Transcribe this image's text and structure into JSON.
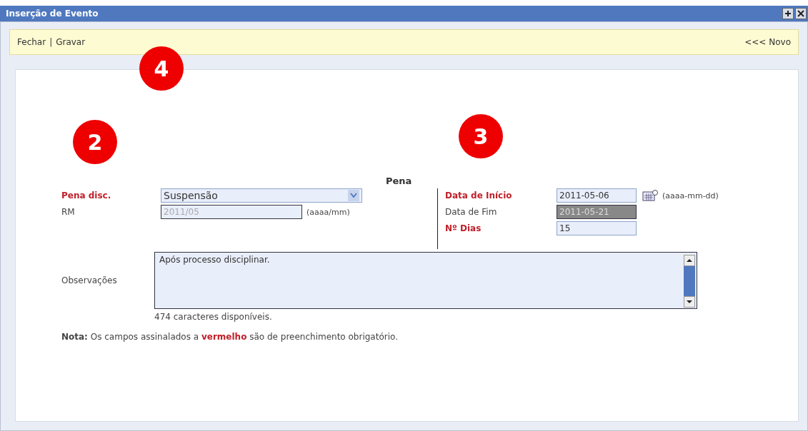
{
  "window": {
    "title": "Inserção de Evento"
  },
  "toolbar": {
    "links": [
      "Fechar",
      "Gravar"
    ],
    "separator": "|",
    "right_link": "<<< Novo"
  },
  "section_title": "Pena",
  "left_fields": [
    {
      "label": "Pena disc.",
      "required": true,
      "kind": "select",
      "value": "Suspensão",
      "disabled": false
    },
    {
      "label": "RM",
      "required": false,
      "kind": "text",
      "value": "2011/05",
      "disabled": true,
      "hint": "(aaaa/mm)"
    }
  ],
  "right_fields": [
    {
      "label": "Data de Início",
      "required": true,
      "kind": "date",
      "value": "2011-05-06",
      "disabled": false,
      "hint": "(aaaa-mm-dd)"
    },
    {
      "label": "Data de Fim",
      "required": false,
      "kind": "text",
      "value": "2011-05-21",
      "disabled": true
    },
    {
      "label": "Nº Dias",
      "required": true,
      "kind": "text",
      "value": "15",
      "disabled": false
    }
  ],
  "observations": {
    "label": "Observações",
    "value": "Após processo disciplinar.",
    "counter": "474 caracteres disponíveis."
  },
  "note": "**Nota:** Os campos assinalados a **vermelho** são de preenchimento obrigatório.",
  "toolbar_badge": "4",
  "left_badge": "2",
  "right_badge": "3"
}
